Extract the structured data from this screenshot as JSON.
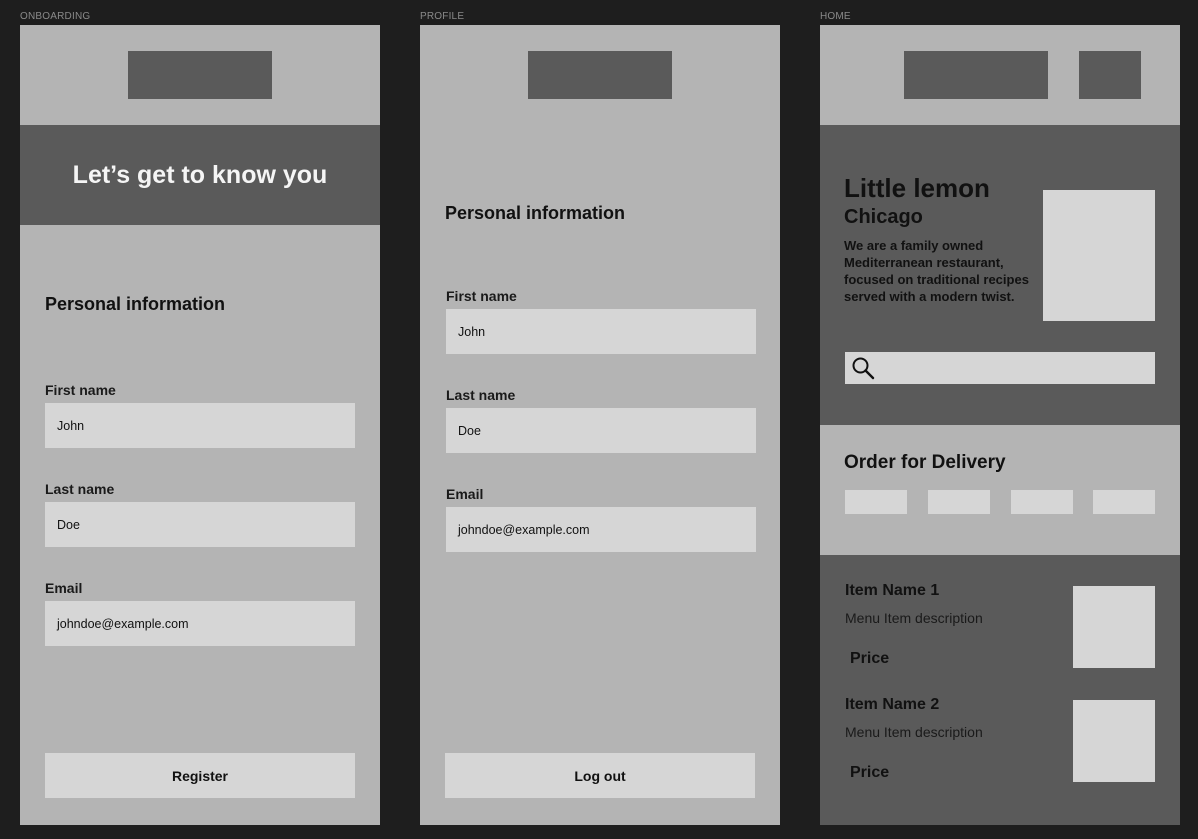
{
  "frames": {
    "onboarding": {
      "label": "ONBOARDING",
      "hero_title": "Let’s get to know you",
      "section_title": "Personal information",
      "first_name_label": "First name",
      "first_name_value": "John",
      "last_name_label": "Last name",
      "last_name_value": "Doe",
      "email_label": "Email",
      "email_value": "johndoe@example.com",
      "button_label": "Register"
    },
    "profile": {
      "label": "PROFILE",
      "section_title": "Personal information",
      "first_name_label": "First name",
      "first_name_value": "John",
      "last_name_label": "Last name",
      "last_name_value": "Doe",
      "email_label": "Email",
      "email_value": "johndoe@example.com",
      "button_label": "Log out"
    },
    "home": {
      "label": "HOME",
      "restaurant_name": "Little lemon",
      "city": "Chicago",
      "description": "We are a family owned Mediterranean restaurant, focused on traditional recipes served with a modern twist.",
      "search_icon": "search-icon",
      "order_title": "Order for Delivery",
      "menu_items": [
        {
          "name": "Item Name 1",
          "description": "Menu Item description",
          "price": "Price"
        },
        {
          "name": "Item Name 2",
          "description": "Menu Item description",
          "price": "Price"
        }
      ]
    }
  },
  "colors": {
    "canvas": "#1e1e1e",
    "frame_bg": "#b4b4b4",
    "dark_placeholder": "#5a5a5a",
    "light_placeholder": "#d6d6d6"
  }
}
